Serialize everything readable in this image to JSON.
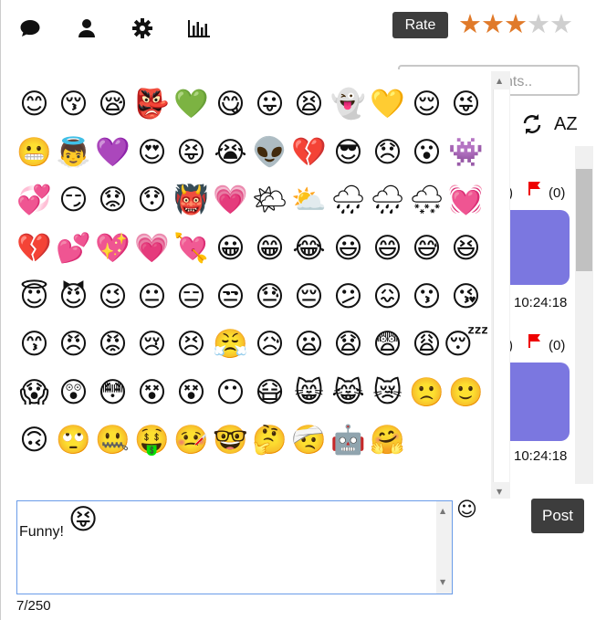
{
  "toolbar": {
    "icons": [
      "chat-icon",
      "user-icon",
      "gear-icon",
      "stats-icon"
    ],
    "rate_label": "Rate",
    "rating": 3,
    "max_rating": 5
  },
  "sidebar": {
    "search_placeholder": "nts..",
    "sort_label": "AZ",
    "messages": [
      {
        "flag_count_left": ")",
        "flag_count": "(0)",
        "time": "10:24:18"
      },
      {
        "flag_count_left": ")",
        "flag_count": "(0)",
        "time": "10:24:18"
      }
    ]
  },
  "emoji_panel": {
    "emojis": [
      "😊",
      "😚",
      "😪",
      "👺",
      "💚",
      "😋",
      "😛",
      "😫",
      "👻",
      "💛",
      "😌",
      "😜",
      "😬",
      "👼",
      "💜",
      "😍",
      "😝",
      "😭",
      "👽",
      "💔",
      "😎",
      "😞",
      "😮",
      "👾",
      "💞",
      "😏",
      "😟",
      "😯",
      "👹",
      "💗",
      "🌤",
      "⛅",
      "🌧",
      "🌧",
      "🌨",
      "💓",
      "💔",
      "💕",
      "💖",
      "💗",
      "💘",
      "😀",
      "😁",
      "😂",
      "😃",
      "😄",
      "😅",
      "😆",
      "😇",
      "😈",
      "😉",
      "😐",
      "😑",
      "😒",
      "😓",
      "😔",
      "😕",
      "😖",
      "😗",
      "😘",
      "😙",
      "😠",
      "😡",
      "😢",
      "😣",
      "😤",
      "😥",
      "😦",
      "😧",
      "😨",
      "😩",
      "😴",
      "😱",
      "😲",
      "😳",
      "😵",
      "😵",
      "😶",
      "😷",
      "😸",
      "😹",
      "😿",
      "🙁",
      "🙂",
      "🙃",
      "🙄",
      "🤐",
      "🤑",
      "🤒",
      "🤓",
      "🤔",
      "🤕",
      "🤖",
      "🤗"
    ]
  },
  "compose": {
    "text": "Funny!",
    "inserted_emoji": "😝",
    "emoji_button": "☺",
    "post_label": "Post",
    "counter": "7/250"
  }
}
